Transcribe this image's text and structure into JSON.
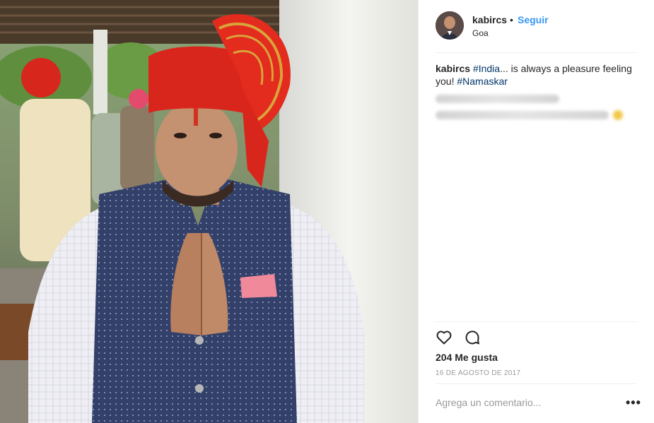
{
  "post": {
    "username": "kabircs",
    "separator": "•",
    "follow_label": "Seguir",
    "location": "Goa"
  },
  "caption": {
    "username": "kabircs",
    "tag1": "#India",
    "text1": "... is always a pleasure feeling you! ",
    "tag2": "#Namaskar"
  },
  "actions": {
    "like_icon": "heart-outline-icon",
    "comment_icon": "speech-bubble-icon"
  },
  "likes": "204 Me gusta",
  "date": "16 DE AGOSTO DE 2017",
  "comment": {
    "placeholder": "Agrega un comentario...",
    "value": ""
  },
  "more_options": "•••",
  "colors": {
    "link_blue": "#3897f0",
    "hashtag": "#003569",
    "turban_red": "#d9261c",
    "vest_navy": "#2f3f6b"
  }
}
